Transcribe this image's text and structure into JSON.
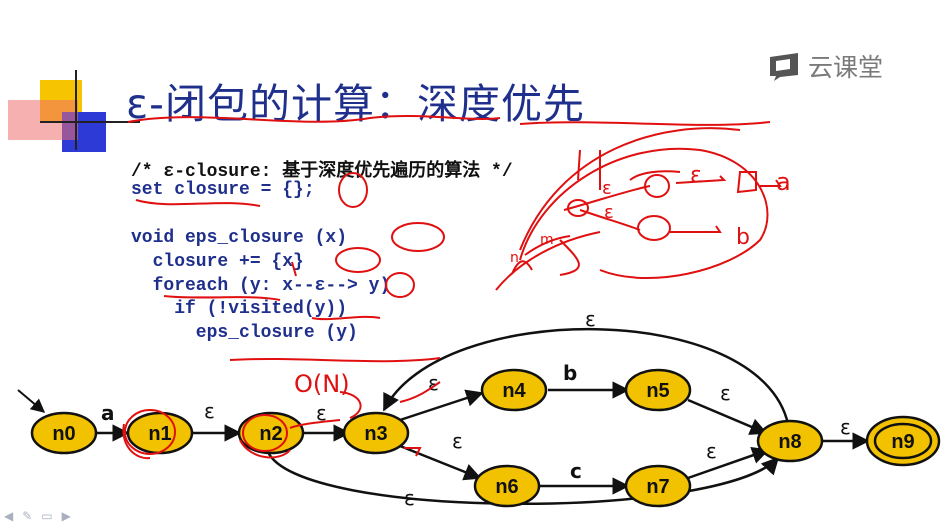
{
  "title": "ε-闭包的计算：深度优先",
  "logo": {
    "text": "云课堂",
    "icon": "cloud-classroom-icon"
  },
  "code": [
    {
      "text": "/* ε-closure: 基于深度优先遍历的算法 */",
      "color": "black"
    },
    {
      "text": "set closure = {};",
      "color": "blue"
    },
    {
      "text": "void eps_closure (x)",
      "color": "blue"
    },
    {
      "text": "  closure += {x}",
      "color": "blue"
    },
    {
      "text": "  foreach (y: x--ε--> y)",
      "color": "blue"
    },
    {
      "text": "    if (!visited(y))",
      "color": "blue"
    },
    {
      "text": "      eps_closure (y)",
      "color": "blue"
    }
  ],
  "handwriting": {
    "complexity": "O(N)",
    "sketch_labels": [
      "ε",
      "a",
      "ε",
      "ε",
      "b",
      "n",
      "m"
    ]
  },
  "nfa": {
    "nodes": [
      "n0",
      "n1",
      "n2",
      "n3",
      "n4",
      "n5",
      "n6",
      "n7",
      "n8",
      "n9"
    ],
    "accepting": "n9",
    "start": "n0",
    "edges": [
      {
        "from": "n0",
        "to": "n1",
        "label": "a"
      },
      {
        "from": "n1",
        "to": "n2",
        "label": "ε"
      },
      {
        "from": "n2",
        "to": "n3",
        "label": "ε"
      },
      {
        "from": "n3",
        "to": "n4",
        "label": "ε"
      },
      {
        "from": "n4",
        "to": "n5",
        "label": "b"
      },
      {
        "from": "n5",
        "to": "n8",
        "label": "ε"
      },
      {
        "from": "n3",
        "to": "n6",
        "label": "ε"
      },
      {
        "from": "n6",
        "to": "n7",
        "label": "c"
      },
      {
        "from": "n7",
        "to": "n8",
        "label": "ε"
      },
      {
        "from": "n8",
        "to": "n9",
        "label": "ε"
      },
      {
        "from": "n8",
        "to": "n3",
        "label": "ε"
      },
      {
        "from": "n2",
        "to": "n8",
        "label": "ε"
      }
    ]
  },
  "colors": {
    "node_fill": "#f2c200",
    "ink": "#e01010",
    "title": "#1f2f8c",
    "code_blue": "#1f2f8c"
  },
  "nav_icons": [
    "arrow-left-icon",
    "pen-icon",
    "menu-icon",
    "arrow-right-icon"
  ]
}
